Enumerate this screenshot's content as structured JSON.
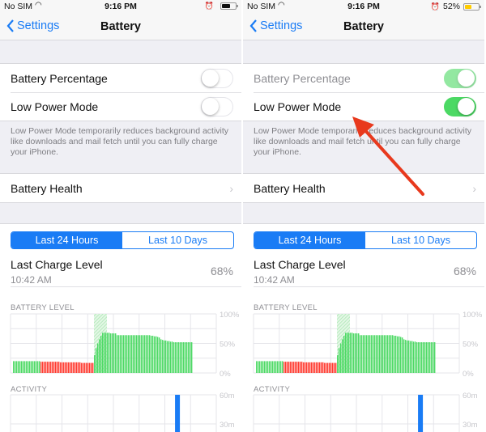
{
  "phones": [
    {
      "status": {
        "carrier": "No SIM",
        "time": "9:16 PM",
        "battery_percent_text": "",
        "battery_fill": 0.6,
        "battery_color": "#111111"
      },
      "nav": {
        "back_label": "Settings",
        "title": "Battery"
      },
      "battery_percentage": {
        "label": "Battery Percentage",
        "on": false,
        "dimmed": false
      },
      "low_power_mode": {
        "label": "Low Power Mode",
        "on": false
      },
      "footer": "Low Power Mode temporarily reduces background activity like downloads and mail fetch until you can fully charge your iPhone.",
      "battery_health": {
        "label": "Battery Health"
      },
      "segment": {
        "options": [
          "Last 24 Hours",
          "Last 10 Days"
        ],
        "selected": 0
      },
      "last_charge": {
        "label": "Last Charge Level",
        "time": "10:42 AM",
        "value": "68%"
      },
      "battery_level_label": "BATTERY LEVEL",
      "activity_label": "ACTIVITY"
    },
    {
      "status": {
        "carrier": "No SIM",
        "time": "9:16 PM",
        "battery_percent_text": "52%",
        "battery_fill": 0.52,
        "battery_color": "#ffcc00"
      },
      "nav": {
        "back_label": "Settings",
        "title": "Battery"
      },
      "battery_percentage": {
        "label": "Battery Percentage",
        "on": true,
        "dimmed": true
      },
      "low_power_mode": {
        "label": "Low Power Mode",
        "on": true
      },
      "footer": "Low Power Mode temporarily reduces background activity like downloads and mail fetch until you can fully charge your iPhone.",
      "battery_health": {
        "label": "Battery Health"
      },
      "segment": {
        "options": [
          "Last 24 Hours",
          "Last 10 Days"
        ],
        "selected": 0
      },
      "last_charge": {
        "label": "Last Charge Level",
        "time": "10:42 AM",
        "value": "68%"
      },
      "battery_level_label": "BATTERY LEVEL",
      "activity_label": "ACTIVITY"
    }
  ],
  "annotation": {
    "arrow_color": "#e8391d",
    "points_to": "Low Power Mode toggle"
  },
  "colors": {
    "accent": "#1a7cf5",
    "switch_on": "#4cd964",
    "battery_green": "#4cd964",
    "battery_red": "#ff3b30",
    "activity_blue": "#1a7cf5"
  },
  "chart_data": [
    {
      "type": "bar",
      "ylim": [
        0,
        100
      ],
      "yticks": [
        "100%",
        "50%",
        "0%"
      ],
      "grid": true,
      "values": [
        20,
        20,
        20,
        20,
        20,
        20,
        20,
        20,
        20,
        20,
        20,
        20,
        20,
        20,
        20,
        20,
        20,
        19,
        19,
        19,
        19,
        19,
        19,
        19,
        19,
        19,
        19,
        19,
        19,
        18,
        18,
        18,
        18,
        18,
        18,
        18,
        18,
        18,
        18,
        18,
        18,
        18,
        17,
        17,
        17,
        17,
        17,
        17,
        17,
        17,
        30,
        42,
        50,
        57,
        63,
        68,
        68,
        68,
        68,
        68,
        67,
        67,
        67,
        67,
        64,
        64,
        64,
        64,
        64,
        64,
        64,
        64,
        64,
        64,
        64,
        64,
        64,
        64,
        64,
        64,
        64,
        64,
        64,
        64,
        64,
        63,
        63,
        62,
        62,
        61,
        60,
        57,
        56,
        55,
        55,
        54,
        54,
        53,
        53,
        52,
        52,
        52,
        52,
        52,
        52,
        52,
        52,
        52,
        52,
        52,
        52
      ],
      "low_series_color_range": [
        17,
        49
      ],
      "charging_range": [
        50,
        54
      ]
    },
    {
      "type": "bar",
      "ylim": [
        0,
        60
      ],
      "yticks": [
        "60m",
        "30m"
      ],
      "grid": true,
      "bars": [
        {
          "hour_index": 19,
          "minutes": 60
        }
      ]
    }
  ]
}
